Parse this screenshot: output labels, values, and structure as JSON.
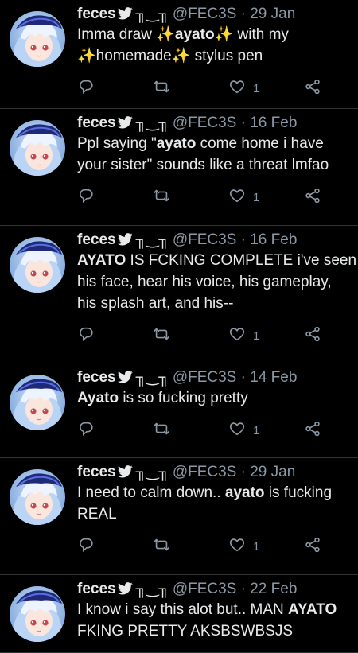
{
  "tweets": [
    {
      "name": "feces",
      "deco": "╖‿╖",
      "handle": "@FEC3S",
      "sep": "·",
      "date": "29 Jan",
      "lines": [
        [
          {
            "t": "Imma draw "
          },
          {
            "t": "✨",
            "em": 1
          },
          {
            "t": "ayato",
            "b": 1
          },
          {
            "t": "✨",
            "em": 1
          },
          {
            "t": " with my"
          }
        ],
        [
          {
            "t": "✨",
            "em": 1
          },
          {
            "t": "homemade"
          },
          {
            "t": "✨",
            "em": 1
          },
          {
            "t": " stylus pen"
          }
        ]
      ],
      "likes": "1"
    },
    {
      "name": "feces",
      "deco": "╖‿╖",
      "handle": "@FEC3S",
      "sep": "·",
      "date": "16 Feb",
      "lines": [
        [
          {
            "t": "Ppl saying \""
          },
          {
            "t": "ayato",
            "b": 1
          },
          {
            "t": " come home i have"
          }
        ],
        [
          {
            "t": "your sister\" sounds like a threat lmfao"
          }
        ]
      ],
      "likes": "1"
    },
    {
      "name": "feces",
      "deco": "╖‿╖",
      "handle": "@FEC3S",
      "sep": "·",
      "date": "16 Feb",
      "lines": [
        [
          {
            "t": "AYATO",
            "b": 1
          },
          {
            "t": " IS FCKING COMPLETE i've seen"
          }
        ],
        [
          {
            "t": "his face, hear his voice, his gameplay,"
          }
        ],
        [
          {
            "t": "his splash art, and his--"
          }
        ]
      ],
      "likes": "1"
    },
    {
      "name": "feces",
      "deco": "╖‿╖",
      "handle": "@FEC3S",
      "sep": "·",
      "date": "14 Feb",
      "lines": [
        [
          {
            "t": "Ayato",
            "b": 1
          },
          {
            "t": " is so fucking pretty"
          }
        ]
      ],
      "likes": "1"
    },
    {
      "name": "feces",
      "deco": "╖‿╖",
      "handle": "@FEC3S",
      "sep": "·",
      "date": "29 Jan",
      "lines": [
        [
          {
            "t": "I need to calm down.. "
          },
          {
            "t": "ayato",
            "b": 1
          },
          {
            "t": " is fucking"
          }
        ],
        [
          {
            "t": "REAL"
          }
        ]
      ],
      "likes": "1"
    },
    {
      "name": "feces",
      "deco": "╖‿╖",
      "handle": "@FEC3S",
      "sep": "·",
      "date": "22 Feb",
      "lines": [
        [
          {
            "t": "I know i say this alot but.. MAN "
          },
          {
            "t": "AYATO",
            "b": 1
          }
        ],
        [
          {
            "t": "FKING PRETTY AKSBSWBSJS"
          }
        ]
      ],
      "likes": ""
    }
  ],
  "icons": {
    "bird": "twitter-bird-icon",
    "reply": "reply-icon",
    "retweet": "retweet-icon",
    "like": "heart-icon",
    "share": "share-icon"
  },
  "colors": {
    "background": "#000000",
    "text": "#e7e9ea",
    "muted": "#8b98a5",
    "divider": "#2f3336",
    "sparkle": "#f5c518"
  }
}
